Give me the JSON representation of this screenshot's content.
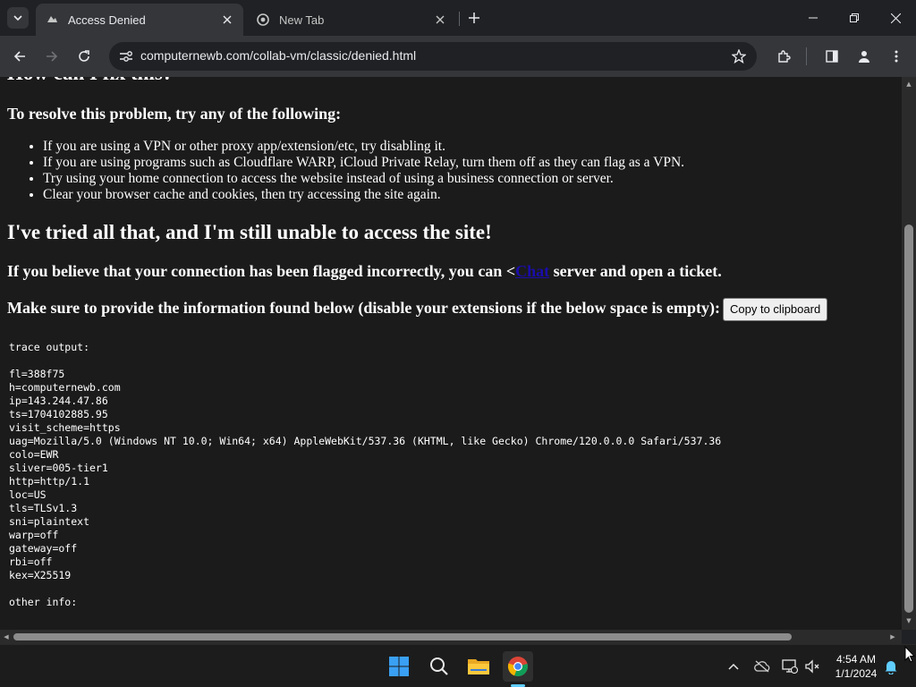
{
  "browser": {
    "tabs": [
      {
        "title": "Access Denied",
        "active": true
      },
      {
        "title": "New Tab",
        "active": false
      }
    ],
    "address_bar": {
      "url": "computernewb.com/collab-vm/classic/denied.html"
    }
  },
  "page": {
    "heading_fix": "How can I fix this?",
    "resolve_heading": "To resolve this problem, try any of the following:",
    "tips": [
      "If you are using a VPN or other proxy app/extension/etc, try disabling it.",
      "If you are using programs such as Cloudflare WARP, iCloud Private Relay, turn them off as they can flag as a VPN.",
      "Try using your home connection to access the website instead of using a business connection or server.",
      "Clear your browser cache and cookies, then try accessing the site again."
    ],
    "heading_tried": "I've tried all that, and I'm still unable to access the site!",
    "flagged_text_before": "If you believe that your connection has been flagged incorrectly, you can <",
    "flagged_link": "Chat",
    "flagged_text_after": " server and open a ticket.",
    "info_text": "Make sure to provide the information found below (disable your extensions if the below space is empty):",
    "copy_button": "Copy to clipboard",
    "trace_label": "trace output:",
    "trace_lines": [
      "fl=388f75",
      "h=computernewb.com",
      "ip=143.244.47.86",
      "ts=1704102885.95",
      "visit_scheme=https",
      "uag=Mozilla/5.0 (Windows NT 10.0; Win64; x64) AppleWebKit/537.36 (KHTML, like Gecko) Chrome/120.0.0.0 Safari/537.36",
      "colo=EWR",
      "sliver=005-tier1",
      "http=http/1.1",
      "loc=US",
      "tls=TLSv1.3",
      "sni=plaintext",
      "warp=off",
      "gateway=off",
      "rbi=off",
      "kex=X25519"
    ],
    "other_info_label": "other info:"
  },
  "taskbar": {
    "time": "4:54 AM",
    "date": "1/1/2024"
  },
  "colors": {
    "chrome_dark": "#202124",
    "toolbar": "#35363a",
    "page_bg": "#1b1b1b",
    "link": "#1a0dab",
    "accent": "#60cdff"
  }
}
